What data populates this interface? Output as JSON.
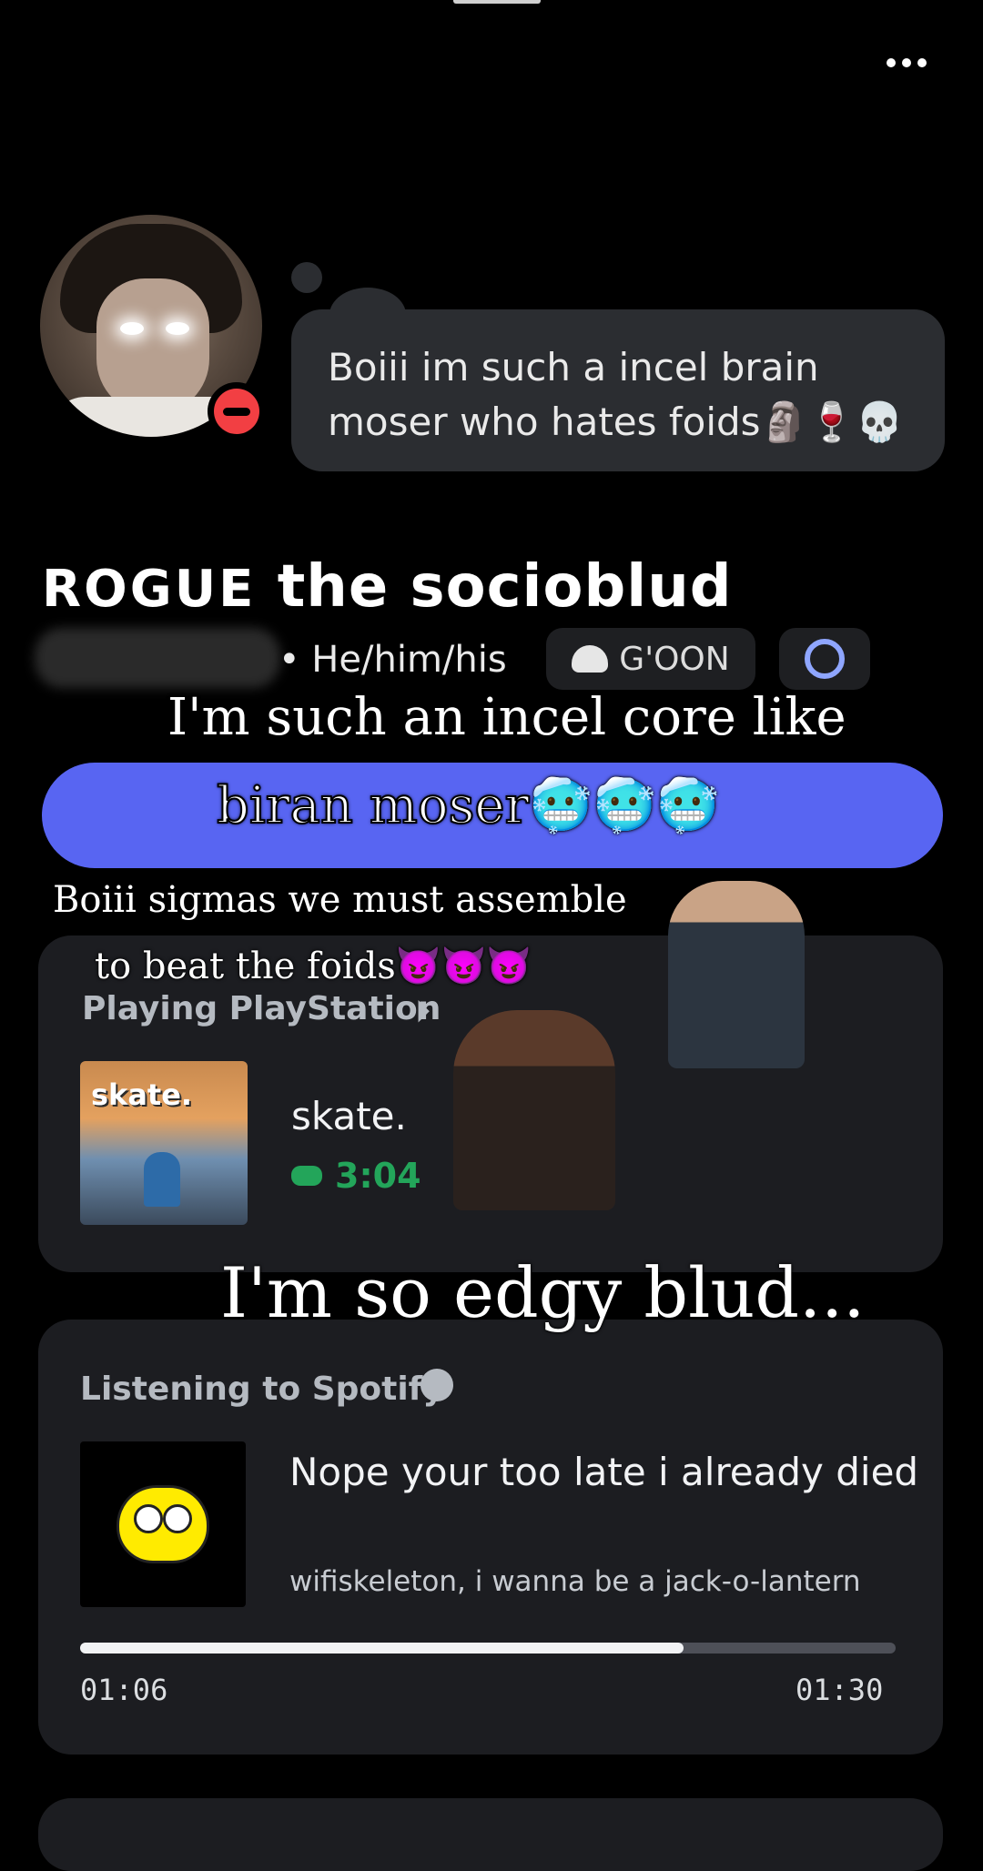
{
  "bubble": {
    "text": "Boiii im such a incel brain moser who hates foids🗿🍷💀"
  },
  "profile": {
    "display_name_prefix": "ROGUE",
    "display_name_rest": "the socioblud",
    "pronouns": "• He/him/his",
    "tag_label": "G'OON"
  },
  "overlay_captions": {
    "line1": "I'm such an incel core like",
    "line2": "biran moser🥶🥶🥶",
    "line3": "Boiii sigmas we must assemble",
    "line4": "to beat the foids😈😈😈",
    "line5": "I'm so edgy blud..."
  },
  "activity": {
    "header": "Playing PlayStation",
    "game_art_logo": "skate.",
    "game_title": "skate.",
    "elapsed": "3:04"
  },
  "spotify": {
    "header": "Listening to Spotify",
    "song": "Nope your too late i already died",
    "artist": "wifiskeleton,  i wanna be a jack-o-lantern",
    "elapsed": "01:06",
    "total": "01:30",
    "progress": 0.74
  },
  "colors": {
    "accent": "#5865f2",
    "dnd": "#f23f43",
    "playing_green": "#23a55a"
  }
}
